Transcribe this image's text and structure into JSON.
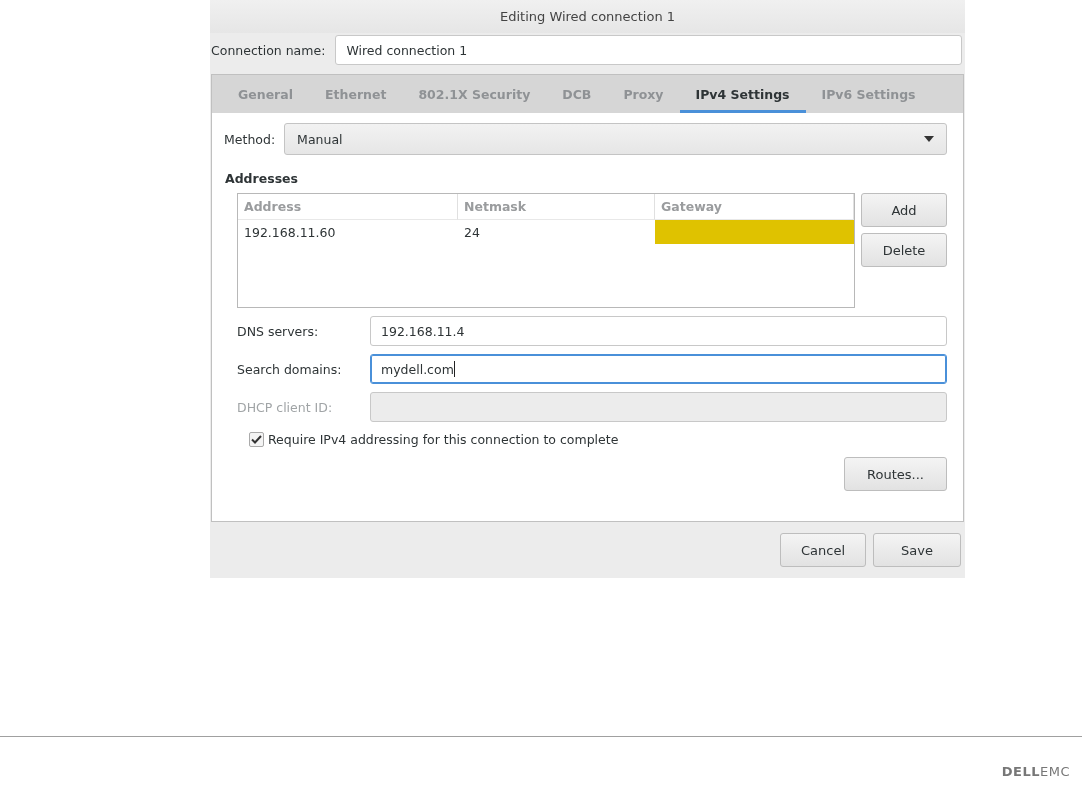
{
  "window": {
    "title": "Editing Wired connection 1"
  },
  "connection_name": {
    "label": "Connection name:",
    "value": "Wired connection 1"
  },
  "tabs": [
    {
      "label": "General",
      "selected": false
    },
    {
      "label": "Ethernet",
      "selected": false
    },
    {
      "label": "802.1X Security",
      "selected": false
    },
    {
      "label": "DCB",
      "selected": false
    },
    {
      "label": "Proxy",
      "selected": false
    },
    {
      "label": "IPv4 Settings",
      "selected": true
    },
    {
      "label": "IPv6 Settings",
      "selected": false
    }
  ],
  "method": {
    "label": "Method:",
    "value": "Manual"
  },
  "addresses": {
    "title": "Addresses",
    "columns": [
      "Address",
      "Netmask",
      "Gateway"
    ],
    "rows": [
      {
        "address": "192.168.11.60",
        "netmask": "24",
        "gateway_editing": true
      }
    ],
    "buttons": [
      "Add",
      "Delete"
    ]
  },
  "fields": [
    {
      "label": "DNS servers:",
      "value": "192.168.11.4",
      "focused": false,
      "disabled": false
    },
    {
      "label": "Search domains:",
      "value": "mydell.com",
      "focused": true,
      "disabled": false
    },
    {
      "label": "DHCP client ID:",
      "focused": false,
      "disabled": true
    }
  ],
  "require_ipv4": {
    "label": "Require IPv4 addressing for this connection to complete",
    "checked": true
  },
  "routes_button": "Routes...",
  "footer_buttons": [
    "Cancel",
    "Save"
  ],
  "page_logo": {
    "part_1": "DELL",
    "part_2": "EMC"
  }
}
